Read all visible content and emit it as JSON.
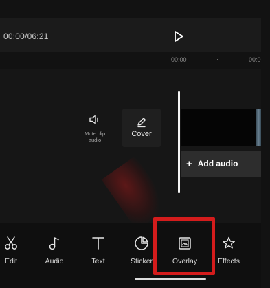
{
  "player": {
    "time": "00:00/06:21",
    "ruler_start": "00:00",
    "ruler_next": "00:0"
  },
  "clip_tools": {
    "mute_label": "Mute clip audio",
    "cover_label": "Cover"
  },
  "timeline": {
    "add_audio_label": "Add audio"
  },
  "toolbar": {
    "items": [
      {
        "label": "Edit",
        "icon": "scissors-icon"
      },
      {
        "label": "Audio",
        "icon": "music-note-icon"
      },
      {
        "label": "Text",
        "icon": "text-icon"
      },
      {
        "label": "Sticker",
        "icon": "sticker-icon"
      },
      {
        "label": "Overlay",
        "icon": "overlay-icon"
      },
      {
        "label": "Effects",
        "icon": "star-icon"
      }
    ]
  },
  "colors": {
    "highlight": "#d41c1c",
    "background": "#121212"
  }
}
